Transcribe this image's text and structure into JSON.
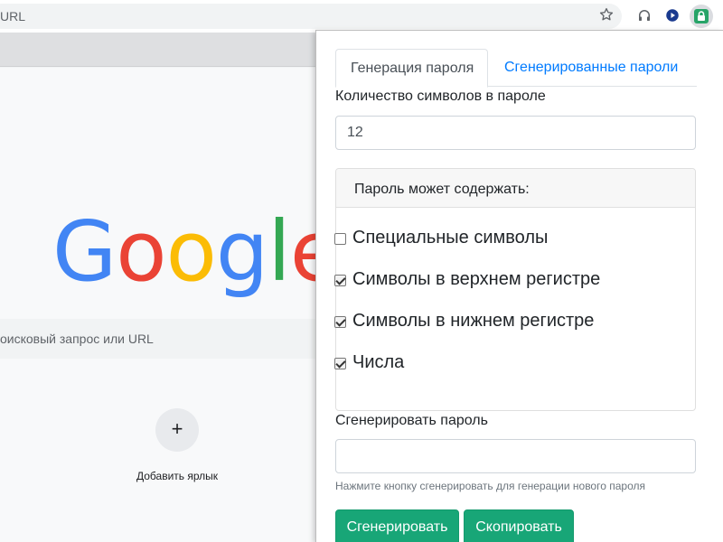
{
  "browser": {
    "omnibox_text": "URL",
    "icons": [
      "star-icon",
      "headphones-icon",
      "play-icon",
      "password-extension-icon"
    ],
    "accent_extension": "#27a468"
  },
  "ntp": {
    "logo": {
      "letters": [
        "G",
        "o",
        "o",
        "g",
        "l",
        "e"
      ]
    },
    "search_placeholder": "оисковый запрос или URL",
    "shortcut_plus": "+",
    "shortcut_label": "Добавить ярлык"
  },
  "popup": {
    "tabs": [
      {
        "label": "Генерация пароля",
        "active": true
      },
      {
        "label": "Сгенерированные пароли",
        "active": false
      }
    ],
    "length_label": "Количество символов в пароле",
    "length_value": "12",
    "options_header": "Пароль может содержать:",
    "options": [
      {
        "label": "Специальные символы",
        "checked": false
      },
      {
        "label": "Символы в верхнем регистре",
        "checked": true
      },
      {
        "label": "Символы в нижнем регистре",
        "checked": true
      },
      {
        "label": "Числа",
        "checked": true
      }
    ],
    "generate_label": "Сгенерировать пароль",
    "generated_value": "",
    "help_text": "Нажмите кнопку сгенерировать для генерации нового пароля",
    "buttons": {
      "generate": "Сгенерировать",
      "copy": "Скопировать"
    },
    "colors": {
      "button": "#18a677",
      "tab_link": "#007bff"
    }
  }
}
